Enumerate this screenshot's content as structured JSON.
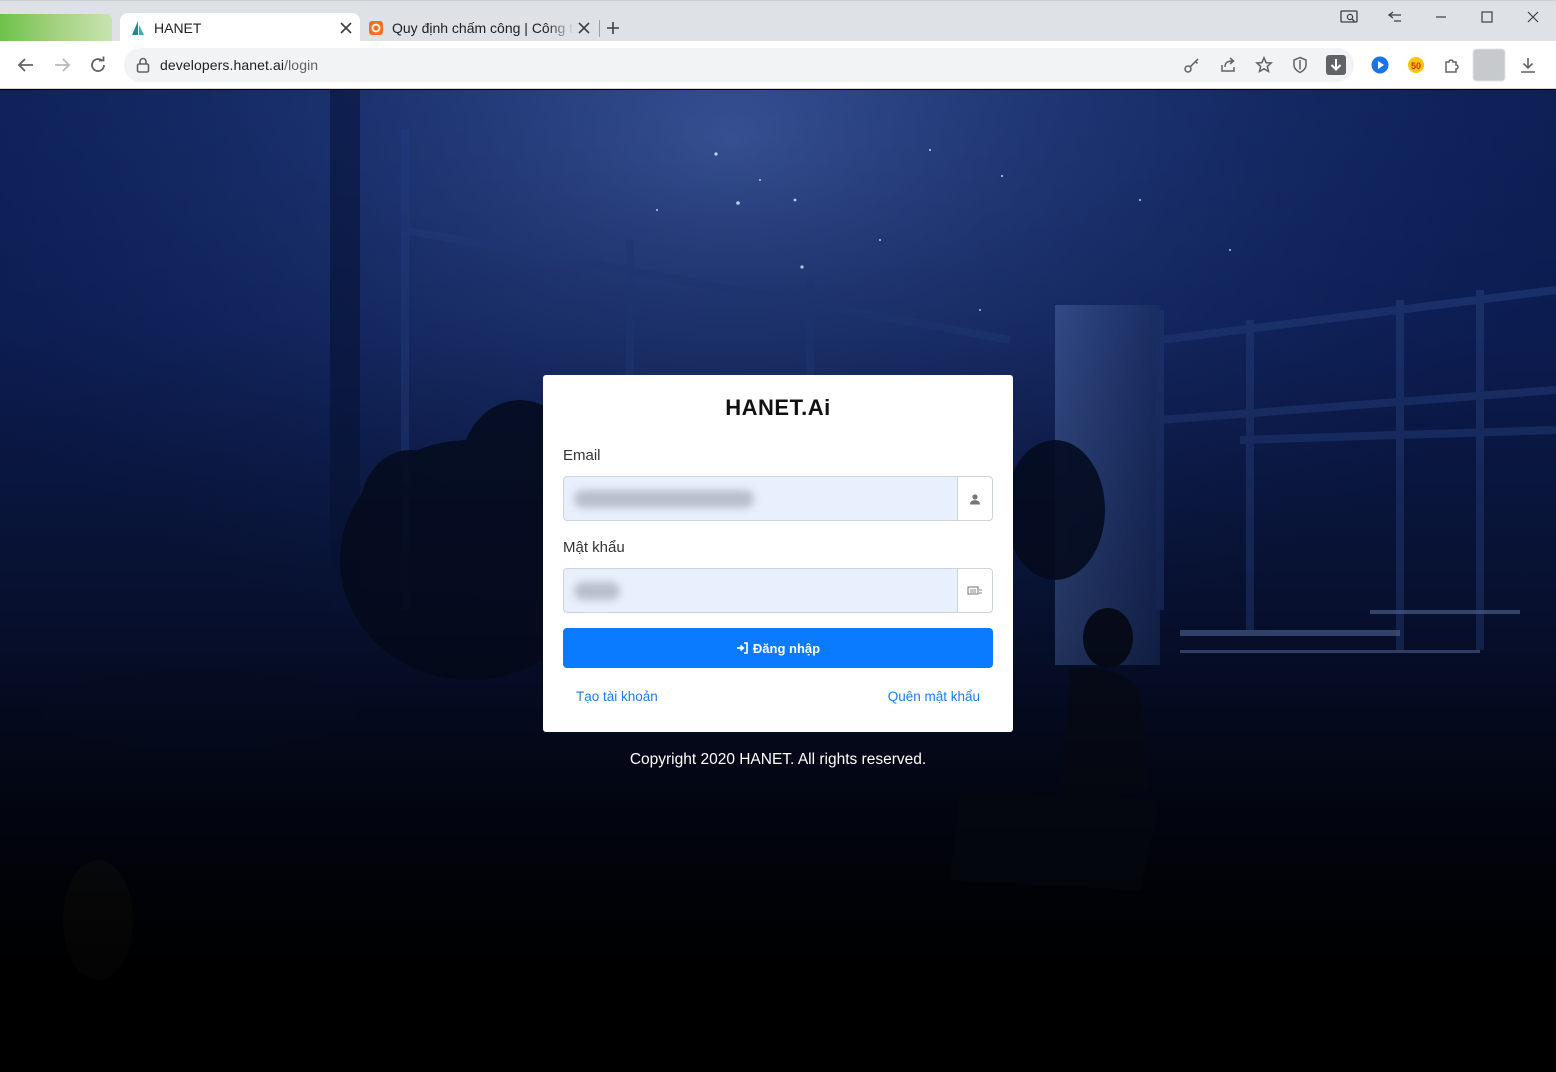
{
  "browser": {
    "tabs": [
      {
        "title": "HANET",
        "active": true
      },
      {
        "title": "Quy định chấm công | Công ty",
        "active": false
      }
    ],
    "url_host": "developers.hanet.ai",
    "url_path": "/login",
    "accent_color": "#0a7bff"
  },
  "login": {
    "logo_text": "HANET.Ai",
    "email_label": "Email",
    "password_label": "Mật khẩu",
    "submit_label": "Đăng nhập",
    "create_account_link": "Tạo tài khoản",
    "forgot_password_link": "Quên mật khẩu"
  },
  "footer": {
    "copyright": "Copyright 2020 HANET. All rights reserved."
  },
  "icons": {
    "tab1": "hanet-sail-icon",
    "tab2": "orange-app-icon",
    "email_addon": "user-icon",
    "password_addon": "keyboard-icon",
    "submit": "sign-in-icon"
  }
}
